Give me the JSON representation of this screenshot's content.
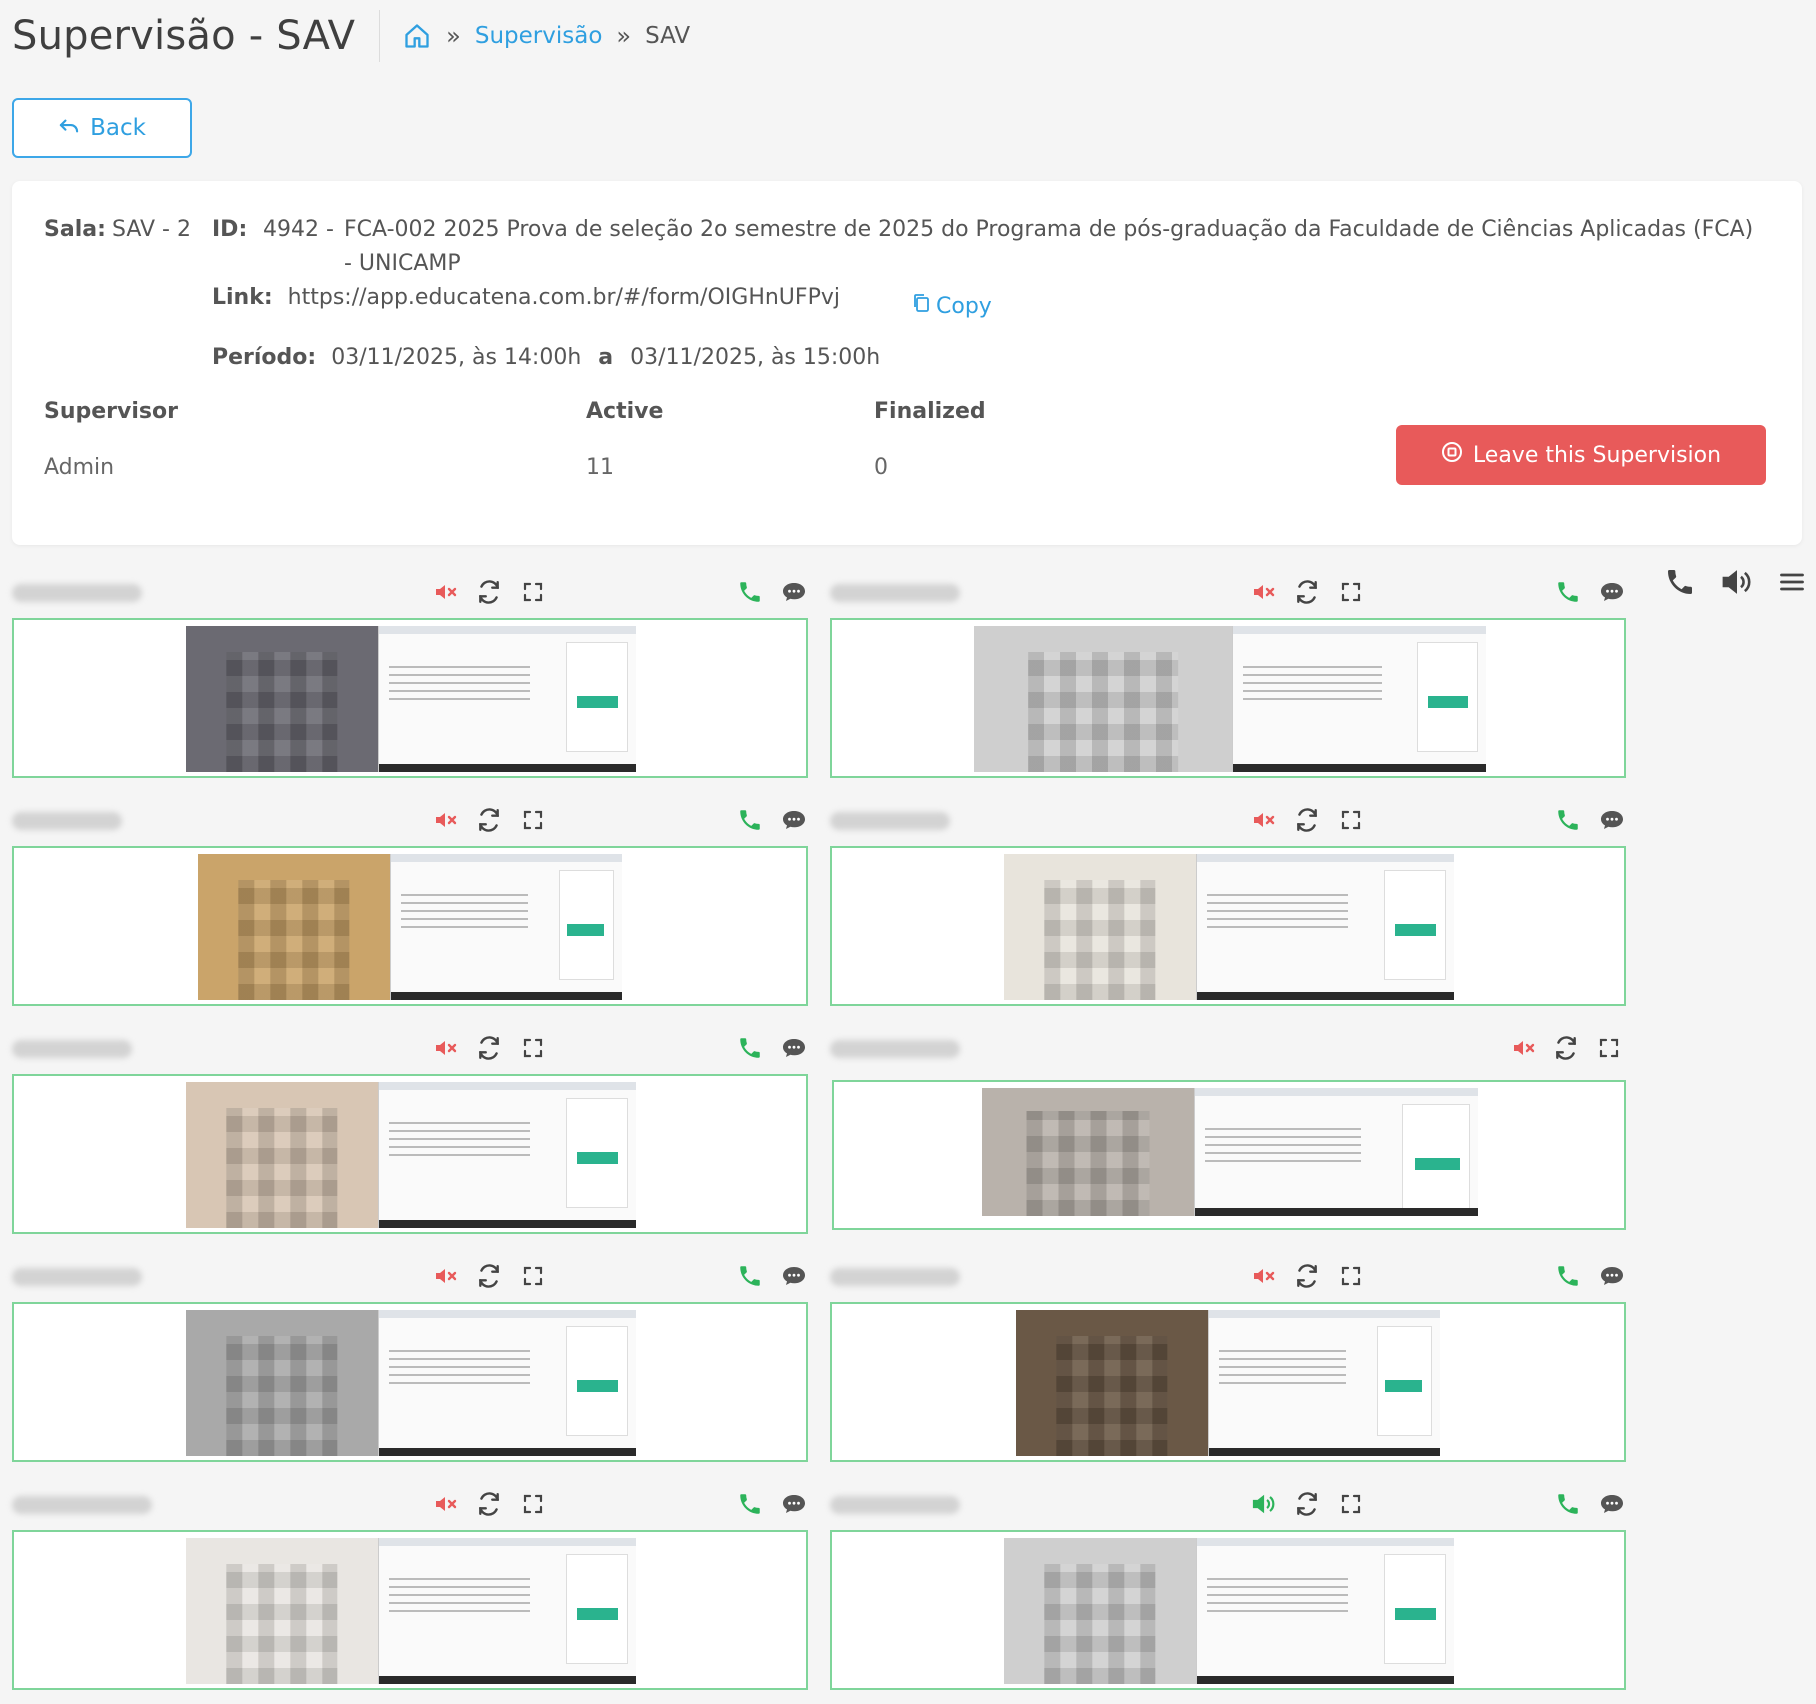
{
  "header": {
    "title": "Supervisão - SAV",
    "breadcrumb": {
      "home_icon": "home-icon",
      "separator": "»",
      "link": "Supervisão",
      "current": "SAV"
    }
  },
  "back_button": {
    "label": "Back",
    "icon": "undo-arrow-icon"
  },
  "info": {
    "sala_label": "Sala:",
    "sala_value": "SAV - 2",
    "id_label": "ID:",
    "id_number": "4942  -",
    "id_description": "FCA-002 2025 Prova de seleção 2o semestre de 2025 do Programa de pós-graduação da Faculdade de Ciências Aplicadas (FCA) - UNICAMP",
    "link_label": "Link:",
    "link_url": "https://app.educatena.com.br/#/form/OIGHnUFPvj",
    "copy_label": "Copy",
    "periodo_label": "Período:",
    "periodo_start": "03/11/2025, às 14:00h",
    "periodo_sep": "a",
    "periodo_end": "03/11/2025, às 15:00h"
  },
  "stats": {
    "supervisor_header": "Supervisor",
    "active_header": "Active",
    "finalized_header": "Finalized",
    "supervisor_value": "Admin",
    "active_value": "11",
    "finalized_value": "0"
  },
  "leave_button": {
    "label": "Leave this Supervision",
    "icon": "stop-circle-icon"
  },
  "colors": {
    "accent": "#2f9fe0",
    "danger": "#e85a5a",
    "success": "#2cb35a",
    "frame": "#7fd59a"
  },
  "tiles": [
    {
      "audio": "muted",
      "call": true,
      "chat": true
    },
    {
      "audio": "muted",
      "call": true,
      "chat": true
    },
    {
      "audio": "muted",
      "call": true,
      "chat": true
    },
    {
      "audio": "muted",
      "call": true,
      "chat": true
    },
    {
      "audio": "muted",
      "call": true,
      "chat": true
    },
    {
      "audio": "muted",
      "call": false,
      "chat": false
    },
    {
      "audio": "muted",
      "call": true,
      "chat": true
    },
    {
      "audio": "muted",
      "call": true,
      "chat": true
    },
    {
      "audio": "muted",
      "call": true,
      "chat": true
    },
    {
      "audio": "on",
      "call": true,
      "chat": true
    }
  ]
}
